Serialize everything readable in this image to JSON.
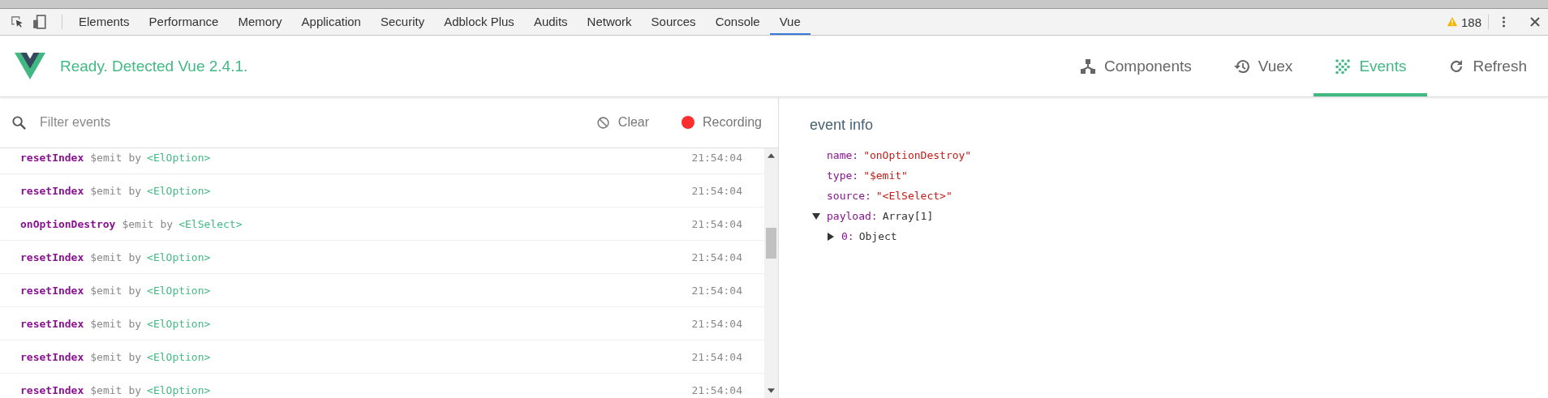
{
  "devtools_tabs": [
    {
      "label": "Elements",
      "selected": false
    },
    {
      "label": "Performance",
      "selected": false
    },
    {
      "label": "Memory",
      "selected": false
    },
    {
      "label": "Application",
      "selected": false
    },
    {
      "label": "Security",
      "selected": false
    },
    {
      "label": "Adblock Plus",
      "selected": false
    },
    {
      "label": "Audits",
      "selected": false
    },
    {
      "label": "Network",
      "selected": false
    },
    {
      "label": "Sources",
      "selected": false
    },
    {
      "label": "Console",
      "selected": false
    },
    {
      "label": "Vue",
      "selected": true
    }
  ],
  "warning_count": "188",
  "status": "Ready. Detected Vue 2.4.1.",
  "nav": [
    {
      "label": "Components",
      "kind": "components",
      "selected": false
    },
    {
      "label": "Vuex",
      "kind": "vuex",
      "selected": false
    },
    {
      "label": "Events",
      "kind": "events",
      "selected": true
    }
  ],
  "refresh_label": "Refresh",
  "filter": {
    "placeholder": "Filter events"
  },
  "clear_label": "Clear",
  "recording": {
    "label": "Recording",
    "on": true
  },
  "events": [
    {
      "name": "resetIndex",
      "type": "$emit",
      "by": "by",
      "source": "<ElOption>",
      "time": "21:54:04"
    },
    {
      "name": "resetIndex",
      "type": "$emit",
      "by": "by",
      "source": "<ElOption>",
      "time": "21:54:04"
    },
    {
      "name": "onOptionDestroy",
      "type": "$emit",
      "by": "by",
      "source": "<ElSelect>",
      "time": "21:54:04"
    },
    {
      "name": "resetIndex",
      "type": "$emit",
      "by": "by",
      "source": "<ElOption>",
      "time": "21:54:04"
    },
    {
      "name": "resetIndex",
      "type": "$emit",
      "by": "by",
      "source": "<ElOption>",
      "time": "21:54:04"
    },
    {
      "name": "resetIndex",
      "type": "$emit",
      "by": "by",
      "source": "<ElOption>",
      "time": "21:54:04"
    },
    {
      "name": "resetIndex",
      "type": "$emit",
      "by": "by",
      "source": "<ElOption>",
      "time": "21:54:04"
    },
    {
      "name": "resetIndex",
      "type": "$emit",
      "by": "by",
      "source": "<ElOption>",
      "time": "21:54:04"
    }
  ],
  "info": {
    "title": "event info",
    "props": [
      {
        "key": "name:",
        "value": "\"onOptionDestroy\"",
        "kind": "string"
      },
      {
        "key": "type:",
        "value": "\"$emit\"",
        "kind": "string"
      },
      {
        "key": "source:",
        "value": "\"<ElSelect>\"",
        "kind": "string"
      },
      {
        "key": "payload:",
        "value": "Array[1]",
        "kind": "object",
        "expanded": true,
        "children": [
          {
            "key": "0:",
            "value": "Object",
            "kind": "object",
            "expanded": false
          }
        ]
      }
    ]
  }
}
